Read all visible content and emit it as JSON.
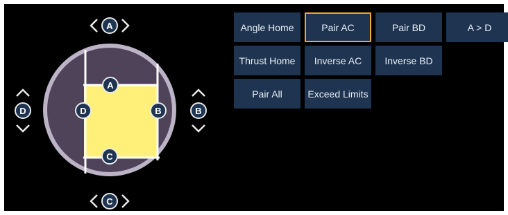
{
  "shutter": {
    "handles": {
      "top": "A",
      "right": "B",
      "bottom": "C",
      "left": "D"
    },
    "inner_handles": {
      "top": "A",
      "right": "B",
      "bottom": "C",
      "left": "D"
    }
  },
  "buttons": [
    {
      "label": "Angle Home",
      "active": false
    },
    {
      "label": "Pair AC",
      "active": true
    },
    {
      "label": "Pair BD",
      "active": false
    },
    {
      "label": "A > D",
      "active": false
    },
    {
      "label": "Thrust Home",
      "active": false
    },
    {
      "label": "Inverse AC",
      "active": false
    },
    {
      "label": "Inverse BD",
      "active": false
    },
    {
      "label": "",
      "active": false
    },
    {
      "label": "Pair All",
      "active": false
    },
    {
      "label": "Exceed Limits",
      "active": false
    }
  ],
  "colors": {
    "background": "#000000",
    "circle_fill": "#4e4358",
    "circle_ring": "#bdb3c6",
    "beam": "#fff07a",
    "handle_fill": "#1e3450",
    "button_fill": "#1e3450",
    "button_active_border": "#f0a928"
  }
}
